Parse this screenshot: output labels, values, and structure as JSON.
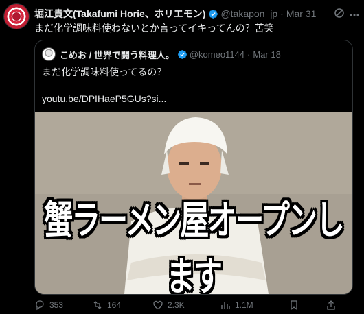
{
  "author": {
    "name": "堀江貴文(Takafumi Horie、ホリエモン)",
    "handle": "@takapon_jp",
    "date": "Mar 31"
  },
  "tweet": {
    "text": "まだ化学調味料使わないとか言ってイキってんの？苦笑"
  },
  "quote": {
    "name": "こめお / 世界で闘う料理人。",
    "handle": "@komeo1144",
    "date": "Mar 18",
    "text": "まだ化学調味料使ってるの？",
    "link": "youtu.be/DPIHaeP5GUs?si...",
    "media_caption": "蟹ラーメン屋オープンします"
  },
  "metrics": {
    "replies": "353",
    "reposts": "164",
    "likes": "2.3K",
    "views": "1.1M"
  },
  "colors": {
    "background": "#000000",
    "text": "#e7e9ea",
    "muted": "#71767b",
    "verified": "#1d9bf0",
    "border": "#2f3336"
  },
  "icons": [
    "verified-badge-icon",
    "grok-icon",
    "more-icon",
    "reply-icon",
    "repost-icon",
    "like-icon",
    "views-icon",
    "bookmark-icon",
    "share-icon"
  ]
}
